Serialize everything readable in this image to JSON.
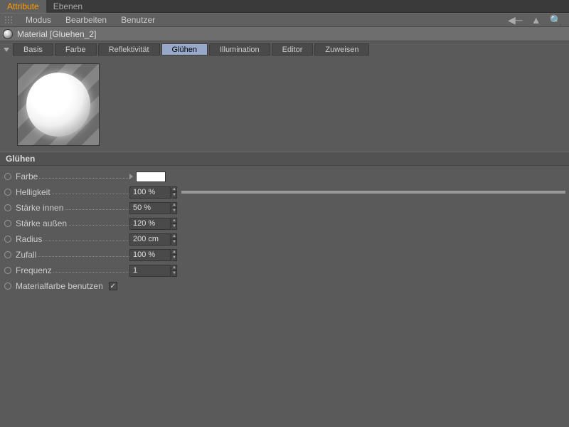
{
  "topTabs": {
    "active": "Attribute",
    "inactive": "Ebenen"
  },
  "menu": {
    "modus": "Modus",
    "bearbeiten": "Bearbeiten",
    "benutzer": "Benutzer"
  },
  "material": {
    "title": "Material [Gluehen_2]"
  },
  "channels": {
    "basis": "Basis",
    "farbe": "Farbe",
    "reflekt": "Reflektivität",
    "gluehen": "Glühen",
    "illum": "Illumination",
    "editor": "Editor",
    "zuweisen": "Zuweisen"
  },
  "section": "Glühen",
  "props": {
    "farbe": "Farbe",
    "helligkeit": {
      "label": "Helligkeit",
      "value": "100 %",
      "fill": 100
    },
    "sinnen": {
      "label": "Stärke innen",
      "value": "50 %"
    },
    "saussen": {
      "label": "Stärke außen",
      "value": "120 %"
    },
    "radius": {
      "label": "Radius",
      "value": "200 cm"
    },
    "zufall": {
      "label": "Zufall",
      "value": "100 %"
    },
    "frequenz": {
      "label": "Frequenz",
      "value": "1"
    },
    "matfarbe": {
      "label": "Materialfarbe benutzen",
      "checked": "✓"
    }
  },
  "colors": {
    "swatch": "#ffffff"
  }
}
